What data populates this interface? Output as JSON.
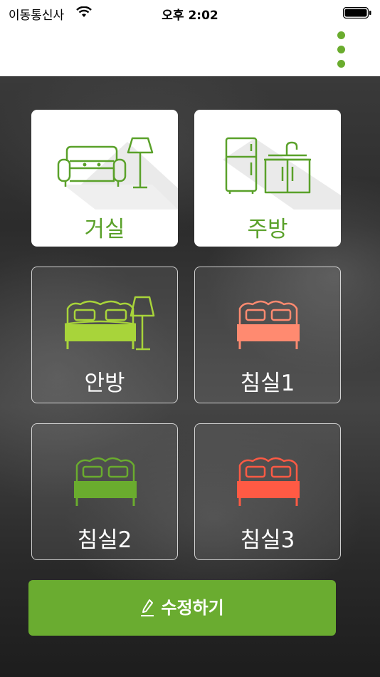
{
  "status_bar": {
    "carrier": "이동통신사",
    "time": "오후 2:02"
  },
  "nav": {
    "menu_icon": "more-vertical-icon",
    "accent": "#6aac2e"
  },
  "rooms": [
    {
      "label": "거실",
      "icon": "sofa-lamp-icon",
      "style": "white",
      "color": "#5aa12a"
    },
    {
      "label": "주방",
      "icon": "kitchen-icon",
      "style": "white",
      "color": "#5aa12a"
    },
    {
      "label": "안방",
      "icon": "bed-lamp-icon",
      "style": "glass",
      "color": "#a8d43a"
    },
    {
      "label": "침실1",
      "icon": "bed-icon",
      "style": "glass",
      "color": "#ff8a70"
    },
    {
      "label": "침실2",
      "icon": "bed-icon",
      "style": "glass",
      "color": "#6aac2e"
    },
    {
      "label": "침실3",
      "icon": "bed-icon",
      "style": "glass",
      "color": "#ff5a44"
    }
  ],
  "edit_button": {
    "label": "수정하기",
    "icon": "pencil-icon",
    "color": "#6aac30"
  }
}
